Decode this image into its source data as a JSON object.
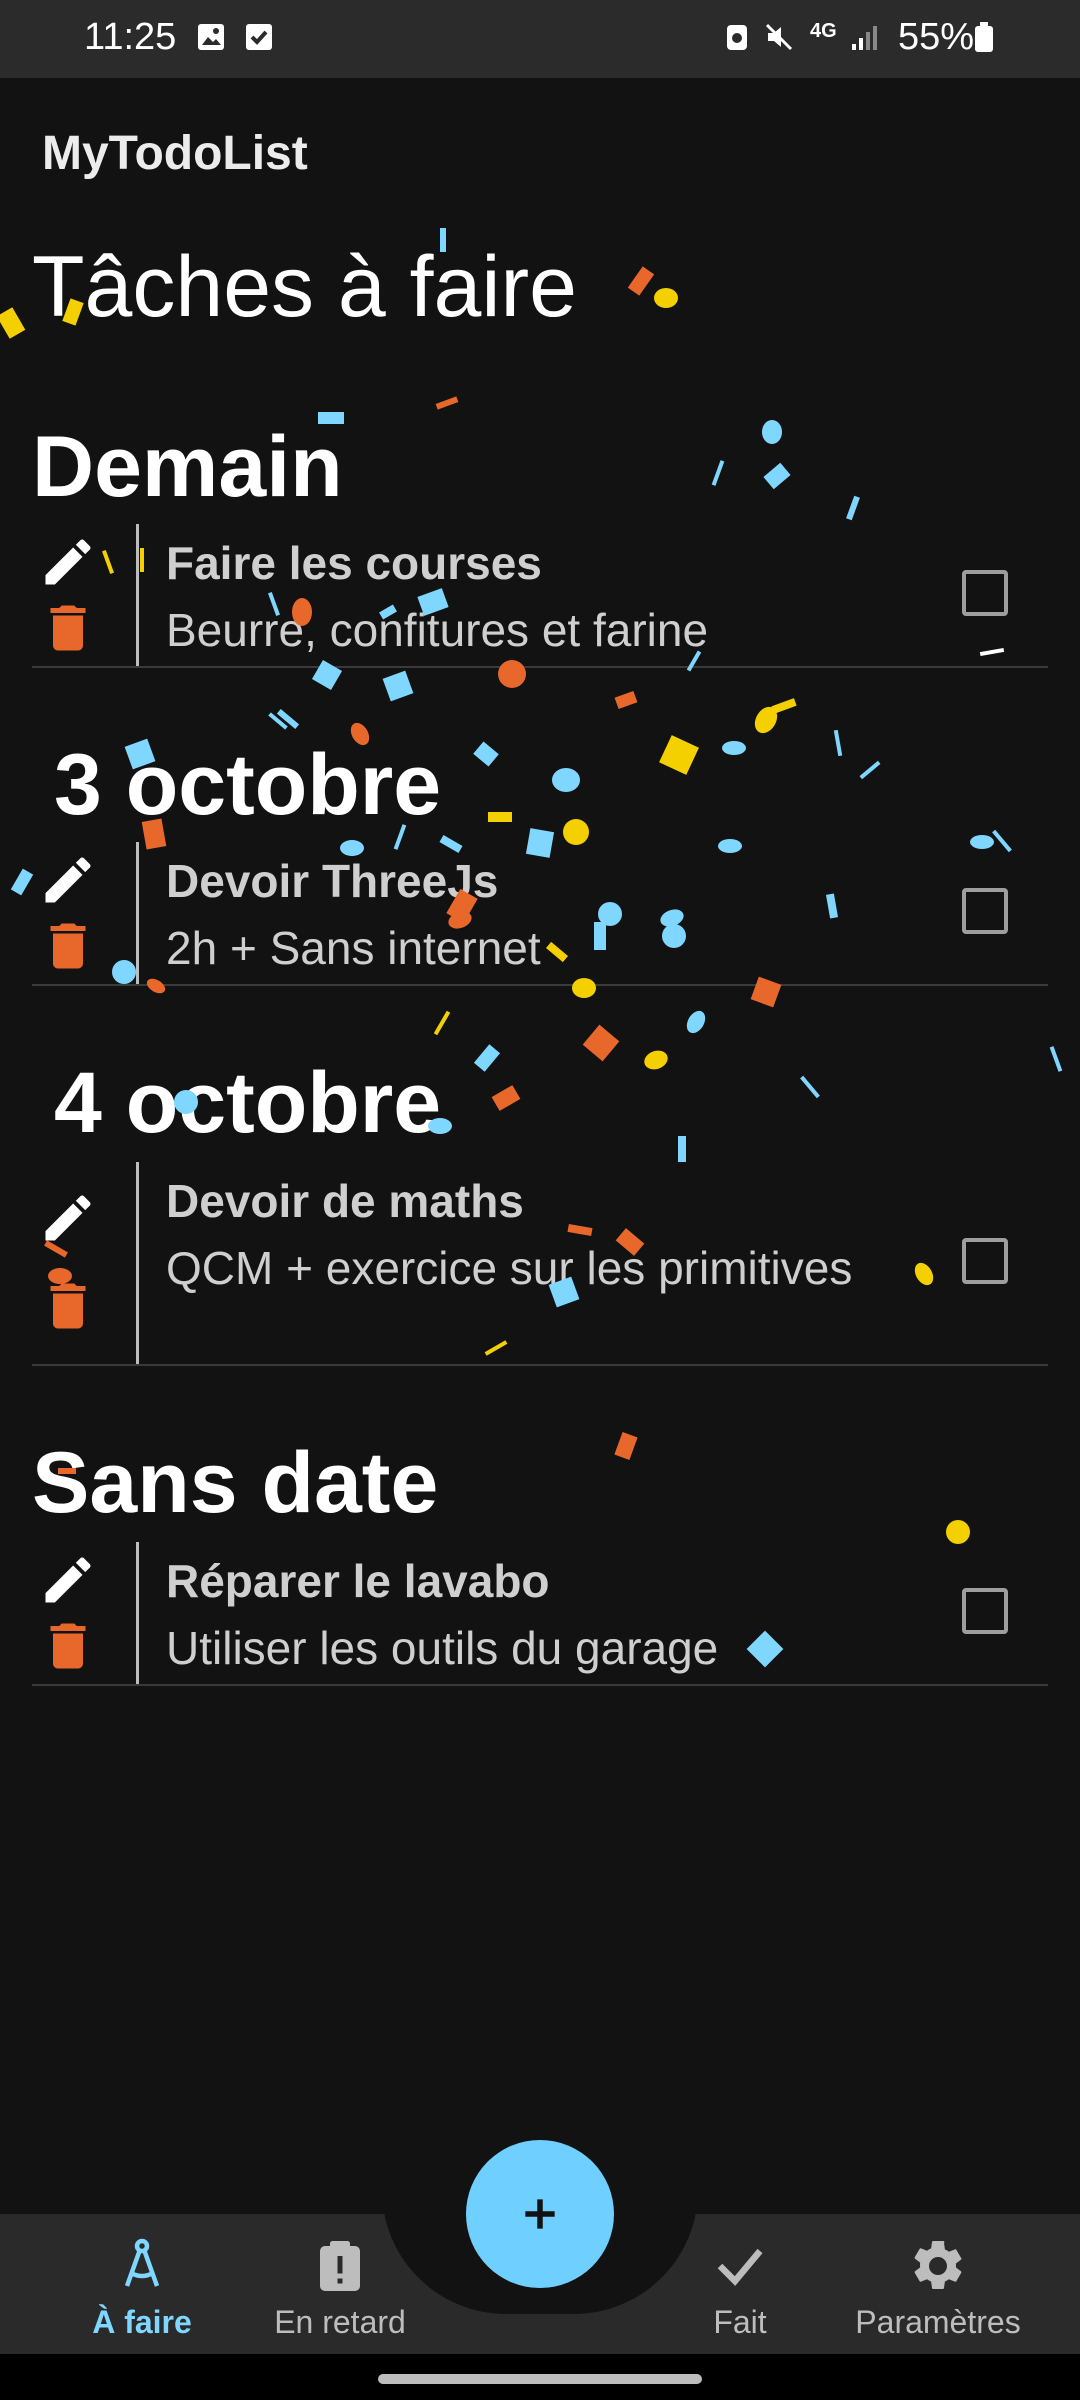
{
  "status_bar": {
    "time": "11:25",
    "battery": "55%",
    "network": "4G",
    "icons": [
      "gallery-icon",
      "checkbox-icon",
      "recycle-icon",
      "mute-icon",
      "signal-icon",
      "battery-icon"
    ]
  },
  "app": {
    "title": "MyTodoList"
  },
  "page": {
    "title": "Tâches à faire"
  },
  "sections": [
    {
      "title": "Demain",
      "tasks": [
        {
          "title": "Faire les courses",
          "description": "Beurre, confitures et farine"
        }
      ]
    },
    {
      "title": "3 octobre",
      "tasks": [
        {
          "title": "Devoir ThreeJs",
          "description": "2h + Sans internet"
        }
      ]
    },
    {
      "title": "4 octobre",
      "tasks": [
        {
          "title": "Devoir de maths",
          "description": "QCM + exercice sur les primitives"
        }
      ]
    },
    {
      "title": "Sans date",
      "tasks": [
        {
          "title": "Réparer le lavabo",
          "description": "Utiliser les outils du garage"
        }
      ]
    }
  ],
  "nav": {
    "items": [
      {
        "label": "À faire",
        "icon": "compass-icon",
        "active": true
      },
      {
        "label": "En retard",
        "icon": "clipboard-alert-icon",
        "active": false
      },
      {
        "label": "Fait",
        "icon": "check-icon",
        "active": false
      },
      {
        "label": "Paramètres",
        "icon": "gear-icon",
        "active": false
      }
    ],
    "fab_icon": "plus-icon"
  },
  "colors": {
    "background": "#121212",
    "accent": "#6fd0ff",
    "delete": "#e8672a",
    "confetti": [
      "#7fd6ff",
      "#f4d000",
      "#e8672a"
    ]
  }
}
